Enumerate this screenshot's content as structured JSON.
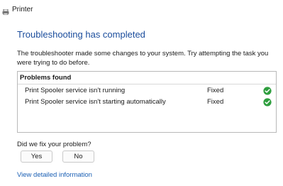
{
  "window": {
    "title": "Printer",
    "icon": "printer-icon"
  },
  "main": {
    "heading": "Troubleshooting has completed",
    "description": "The troubleshooter made some changes to your system. Try attempting the task you were trying to do before."
  },
  "problems": {
    "header": "Problems found",
    "items": [
      {
        "text": "Print Spooler service isn't running",
        "status": "Fixed",
        "icon": "check-icon"
      },
      {
        "text": "Print Spooler service isn't starting automatically",
        "status": "Fixed",
        "icon": "check-icon"
      }
    ]
  },
  "feedback": {
    "question": "Did we fix your problem?",
    "yes_label": "Yes",
    "no_label": "No"
  },
  "link": {
    "detailed_info": "View detailed information"
  },
  "colors": {
    "heading": "#1a4c9c",
    "link": "#1a5fb4",
    "success": "#2e9e3e"
  }
}
